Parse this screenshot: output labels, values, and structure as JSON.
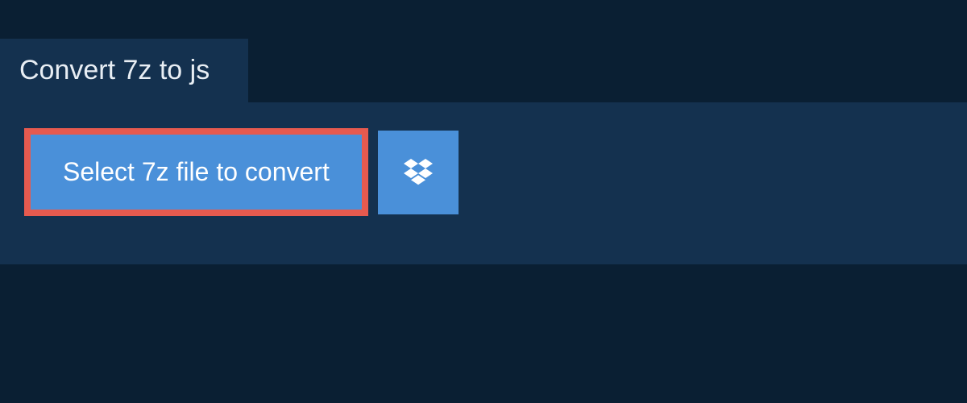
{
  "header": {
    "title": "Convert 7z to js"
  },
  "actions": {
    "select_file_label": "Select 7z file to convert"
  },
  "colors": {
    "background": "#0a1f33",
    "panel": "#14314f",
    "button": "#4a90d9",
    "highlight": "#e65a4f",
    "text_light": "#ffffff"
  }
}
